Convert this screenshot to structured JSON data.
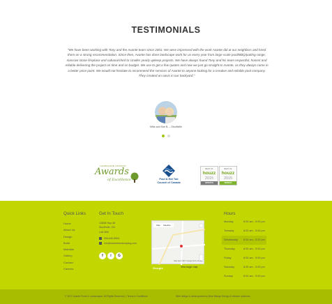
{
  "testimonials": {
    "title": "TESTIMONIALS",
    "quote": "\"We have been working with Tony and the Avante team since 2001. We were impressed with the work Avante did at our neighbors and hired them on a strong recommendation. Since then, Avante has done landscape work for us every year from large scale pool/BBQ/putting range, massive stone fireplace and cabana/shed to smaller yearly upkeep projects. We have always found Tony and his team respectful, honest and reliable delivering the project on time and on budget. We use to get a few quotes and now we just go straight to Avante, as they always come in a better price point. We would not hesitate to recommend the services of Avante to anyone looking for a creative and reliable pool company. They created an oasis in our backyard.\"",
    "author": "Mike and Sue B. – Stouffville",
    "carousel_total": 2,
    "carousel_active": 1
  },
  "logos": {
    "award_small": "LANDSCAPE ONTARIO",
    "award_main": "Awards",
    "award_sub": "of Excellence",
    "pool_text_line1": "Pool & Hot Tub",
    "pool_text_line2": "Council of Canada",
    "houzz1": {
      "best": "BEST OF",
      "name": "houzz",
      "year": "2015",
      "band": "SERVICE"
    },
    "houzz2": {
      "best": "BEST OF",
      "name": "houzz",
      "year": "2015",
      "band": "DESIGN"
    }
  },
  "footer": {
    "quick_links_heading": "Quick Links",
    "quick_links": [
      "Home",
      "About Us",
      "Design",
      "Build",
      "Maintain",
      "Gallery",
      "Contact",
      "Careers"
    ],
    "get_in_touch_heading": "Get In Touch",
    "address": [
      "13808 Hwy 48",
      "Stouffville, ON",
      "L4A 3B8"
    ],
    "phone": "905-640-8900",
    "email": "info@avantelandscaping.com",
    "social": [
      "f",
      "i",
      "G"
    ],
    "map": {
      "map_tab": "Map",
      "satellite_tab": "Satellite",
      "credit": "Map data ©2017 Google   Terms of Use",
      "view_larger": "View larger map",
      "google_label": "Google"
    },
    "hours_heading": "Hours",
    "hours": [
      {
        "day": "Monday",
        "time": "8:30 am - 5:30 pm",
        "highlight": false
      },
      {
        "day": "Tuesday",
        "time": "8:30 am - 5:30 pm",
        "highlight": false
      },
      {
        "day": "Wednesday",
        "time": "8:30 am - 5:30 pm",
        "highlight": true
      },
      {
        "day": "Thursday",
        "time": "8:30 am - 5:30 pm",
        "highlight": false
      },
      {
        "day": "Friday",
        "time": "8:30 am - 5:30 pm",
        "highlight": false
      },
      {
        "day": "Saturday",
        "time": "8:30 am - 5:30 pm",
        "highlight": false
      },
      {
        "day": "Sunday",
        "time": "8:30 am - 5:30 pm",
        "highlight": false
      }
    ],
    "copyright": "© 2017 Avante Pools & Landscapes. All Rights Reserved. | Terms & Conditions",
    "credit": "Web design & development by Blue Mango Design & mission solutions"
  },
  "colors": {
    "accent": "#c2d700",
    "bottom_bar": "#a9bd00",
    "highlight": "#b2c600"
  }
}
